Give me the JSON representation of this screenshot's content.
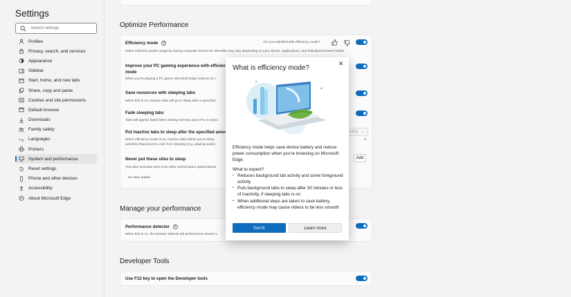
{
  "sidebar": {
    "title": "Settings",
    "search_placeholder": "Search settings",
    "items": [
      {
        "label": "Profiles",
        "icon": "person-icon"
      },
      {
        "label": "Privacy, search, and services",
        "icon": "lock-icon"
      },
      {
        "label": "Appearance",
        "icon": "appearance-icon"
      },
      {
        "label": "Sidebar",
        "icon": "sidebar-icon"
      },
      {
        "label": "Start, home, and new tabs",
        "icon": "home-icon"
      },
      {
        "label": "Share, copy and paste",
        "icon": "share-icon"
      },
      {
        "label": "Cookies and site permissions",
        "icon": "cookie-icon"
      },
      {
        "label": "Default browser",
        "icon": "browser-icon"
      },
      {
        "label": "Downloads",
        "icon": "download-icon"
      },
      {
        "label": "Family safety",
        "icon": "family-icon"
      },
      {
        "label": "Languages",
        "icon": "language-icon"
      },
      {
        "label": "Printers",
        "icon": "printer-icon"
      },
      {
        "label": "System and performance",
        "icon": "system-icon",
        "active": true
      },
      {
        "label": "Reset settings",
        "icon": "reset-icon"
      },
      {
        "label": "Phone and other devices",
        "icon": "phone-icon"
      },
      {
        "label": "Accessibility",
        "icon": "accessibility-icon"
      },
      {
        "label": "About Microsoft Edge",
        "icon": "edge-icon"
      }
    ]
  },
  "main": {
    "optimize_heading": "Optimize Performance",
    "efficiency_mode": {
      "title": "Efficiency mode",
      "feedback_question": "Are you satisfied with efficiency mode?",
      "desc": "Helps minimize power usage by saving computer resources. Benefits may vary depending on your device, applications, and individual browser habits."
    },
    "gaming": {
      "title_line1": "Improve your PC gaming experience with efficiency",
      "title_line2": "mode",
      "desc": "When you're playing a PC game, Microsoft Edge reduces its c"
    },
    "sleeping_tabs": {
      "title": "Save resources with sleeping tabs",
      "desc": "When this is on, inactive tabs will go to sleep after a specified"
    },
    "fade_tabs": {
      "title": "Fade sleeping tabs",
      "desc": "Tabs will appear faded when saving memory and CPU to impro"
    },
    "put_inactive": {
      "title": "Put inactive tabs to sleep after the specified amoun",
      "desc_line1": "When efficiency mode is on, inactive tabs will be put to sleep",
      "desc_line2": "activities that prevent a site from sleeping (e.g. playing audio)",
      "dropdown_partial": "ctivity"
    },
    "never_sleep": {
      "title": "Never put these sites to sleep",
      "desc": "This also excludes sites from other performance optimizations",
      "add_label": "Add",
      "empty_text": "No sites added"
    },
    "manage_heading": "Manage your performance",
    "perf_detector": {
      "title": "Performance detector",
      "desc": "When this is on, the browser detects tab performance issues a"
    },
    "dev_heading": "Developer Tools",
    "f12": {
      "title": "Use F12 key to open the Developer tools"
    }
  },
  "dialog": {
    "title": "What is efficiency mode?",
    "intro": "Efficiency mode helps save device battery and reduce power consumption when you're browsing on Microsoft Edge.",
    "expect_label": "What to expect?",
    "bullets": [
      "Reduces background tab activity and some foreground activity",
      "Puts background tabs to sleep after 30 minutes or less of inactivity, if sleeping tabs is on",
      "When additional steps are taken to save battery, efficiency mode may cause videos to be less smooth"
    ],
    "got_it": "Got it!",
    "learn_more": "Learn more"
  },
  "colors": {
    "accent": "#0f6cbd",
    "background": "#f3f3f3",
    "card": "#fbfbfb"
  }
}
